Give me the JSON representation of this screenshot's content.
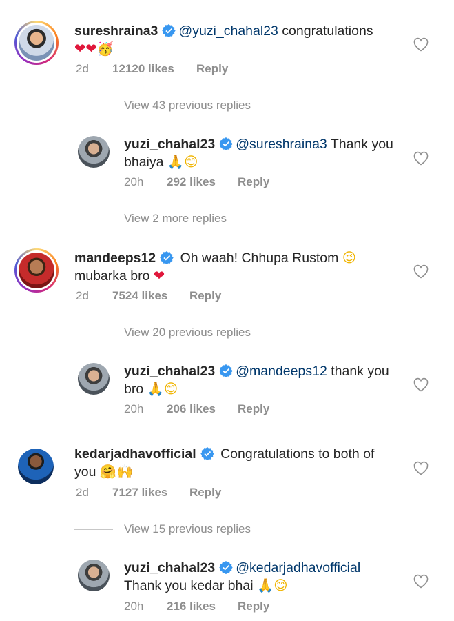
{
  "comments": [
    {
      "username": "sureshraina3",
      "mention": "@yuzi_chahal23",
      "text": " congratulations",
      "line2_emoji": "❤❤🥳",
      "time": "2d",
      "likes": "12120 likes",
      "reply_label": "Reply",
      "view_replies": "View 43 previous replies",
      "reply": {
        "username": "yuzi_chahal23",
        "mention": "@sureshraina3",
        "text": " Thank you",
        "line2_text": "bhaiya ",
        "line2_emoji": "🙏😊",
        "time": "20h",
        "likes": "292 likes",
        "reply_label": "Reply"
      },
      "more_replies": "View 2 more replies"
    },
    {
      "username": "mandeeps12",
      "text": " Oh waah! Chhupa Rustom ",
      "emoji": "😉",
      "line2_text": "mubarka bro ",
      "line2_emoji": "❤",
      "time": "2d",
      "likes": "7524 likes",
      "reply_label": "Reply",
      "view_replies": "View 20 previous replies",
      "reply": {
        "username": "yuzi_chahal23",
        "mention": "@mandeeps12",
        "text": " thank you",
        "line2_text": "bro ",
        "line2_emoji": "🙏😊",
        "time": "20h",
        "likes": "206 likes",
        "reply_label": "Reply"
      }
    },
    {
      "username": "kedarjadhavofficial",
      "text": " Congratulations to both of",
      "line2_text": "you ",
      "line2_emoji": "🤗🙌",
      "time": "2d",
      "likes": "7127 likes",
      "reply_label": "Reply",
      "view_replies": "View 15 previous replies",
      "reply": {
        "username": "yuzi_chahal23",
        "mention": "@kedarjadhavofficial",
        "line2_text": "Thank you kedar bhai ",
        "line2_emoji": "🙏😊",
        "time": "20h",
        "likes": "216 likes",
        "reply_label": "Reply"
      }
    }
  ],
  "colors": {
    "mention": "#00376b",
    "meta": "#8e8e8e",
    "verified": "#3897f0",
    "heart": "#e0173b"
  },
  "icons": {
    "verified": "verified-badge-icon",
    "like": "heart-outline-icon"
  }
}
